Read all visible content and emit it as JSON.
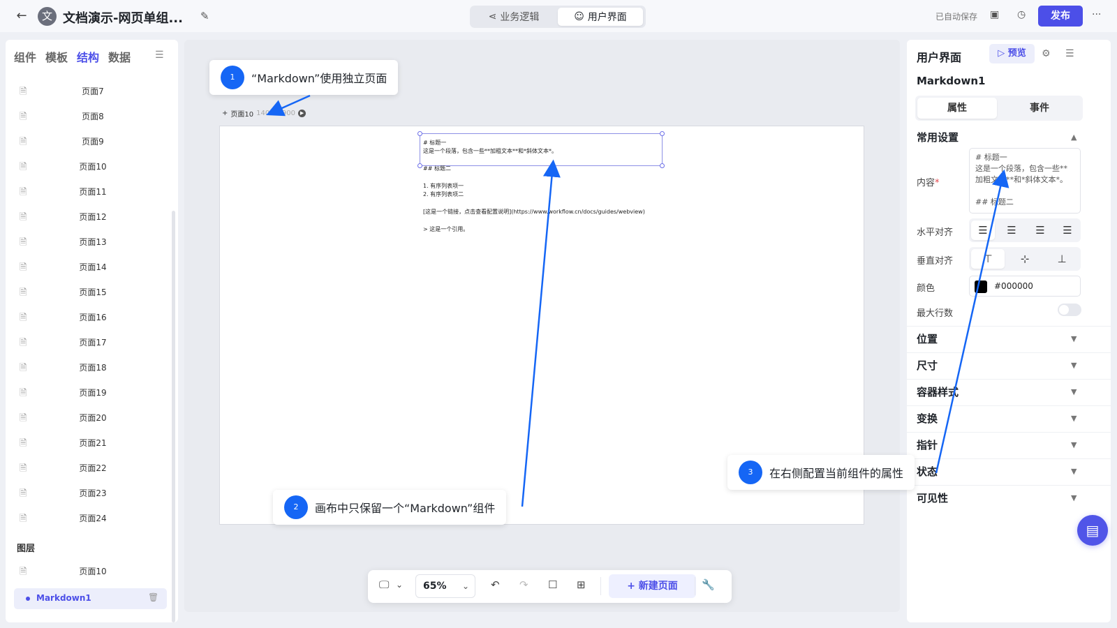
{
  "topbar": {
    "app_initial": "文",
    "title": "文档演示-网页单组...",
    "mode_tabs": {
      "logic": "业务逻辑",
      "ui": "用户界面"
    },
    "autosave": "已自动保存",
    "publish": "发布"
  },
  "left": {
    "tabs": [
      "组件",
      "模板",
      "结构",
      "数据"
    ],
    "pages": [
      "页面7",
      "页面8",
      "页面9",
      "页面10",
      "页面11",
      "页面12",
      "页面13",
      "页面14",
      "页面15",
      "页面16",
      "页面17",
      "页面18",
      "页面19",
      "页面20",
      "页面21",
      "页面22",
      "页面23",
      "页面24"
    ],
    "layers_title": "图层",
    "layer_page": "页面10",
    "layer_component": "Markdown1"
  },
  "canvas": {
    "page_name": "页面10",
    "page_size": "1400 * 900",
    "md_lines": [
      "# 标题一",
      "这是一个段落，包含一些**加粗文本**和*斜体文本*。",
      "## 标题二",
      "1. 有序列表项一",
      "2. 有序列表项二",
      "[这是一个链接，点击查看配置说明](https://www.workflow.cn/docs/guides/webview)",
      "> 这是一个引用。"
    ]
  },
  "callouts": {
    "c1": {
      "num": "1",
      "text": "“Markdown”使用独立页面"
    },
    "c2": {
      "num": "2",
      "text": "画布中只保留一个“Markdown”组件"
    },
    "c3": {
      "num": "3",
      "text": "在右侧配置当前组件的属性"
    }
  },
  "bottom": {
    "zoom": "65%",
    "new_page": "新建页面"
  },
  "right": {
    "title": "用户界面",
    "preview": "预览",
    "component_name": "Markdown1",
    "tabs": {
      "attr": "属性",
      "event": "事件"
    },
    "common_settings": "常用设置",
    "content_label": "内容",
    "content_value": "# 标题一\n这是一个段落，包含一些**加粗文本**和*斜体文本*。\n\n## 标题二",
    "h_align_label": "水平对齐",
    "v_align_label": "垂直对齐",
    "color_label": "颜色",
    "color_value": "#000000",
    "max_lines_label": "最大行数",
    "sections": [
      "位置",
      "尺寸",
      "容器样式",
      "变换",
      "指针",
      "状态",
      "可见性"
    ]
  },
  "colors": {
    "accent": "#4c4fe8",
    "callout": "#1566f5"
  }
}
